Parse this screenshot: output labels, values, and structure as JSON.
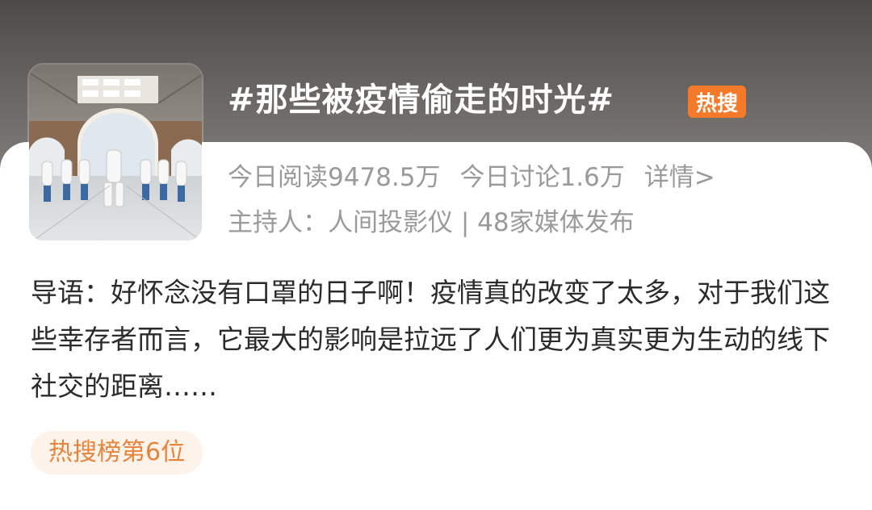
{
  "topic": {
    "title": "#那些被疫情偷走的时光#",
    "badge": "热搜"
  },
  "stats": {
    "today_reads": "今日阅读9478.5万",
    "today_discussions": "今日讨论1.6万",
    "details_link": "详情>"
  },
  "host": {
    "text": "主持人：人间投影仪 | 48家媒体发布"
  },
  "intro": {
    "text": "导语：好怀念没有口罩的日子啊！疫情真的改变了太多，对于我们这些幸存者而言，它最大的影响是拉远了人们更为真实更为生动的线下社交的距离……"
  },
  "rank": {
    "label": "热搜榜第6位"
  },
  "colors": {
    "badge": "#f47a2a",
    "rank_text": "#e8843a",
    "rank_bg": "#fdf3ea",
    "muted_text": "#9a9a9a"
  }
}
